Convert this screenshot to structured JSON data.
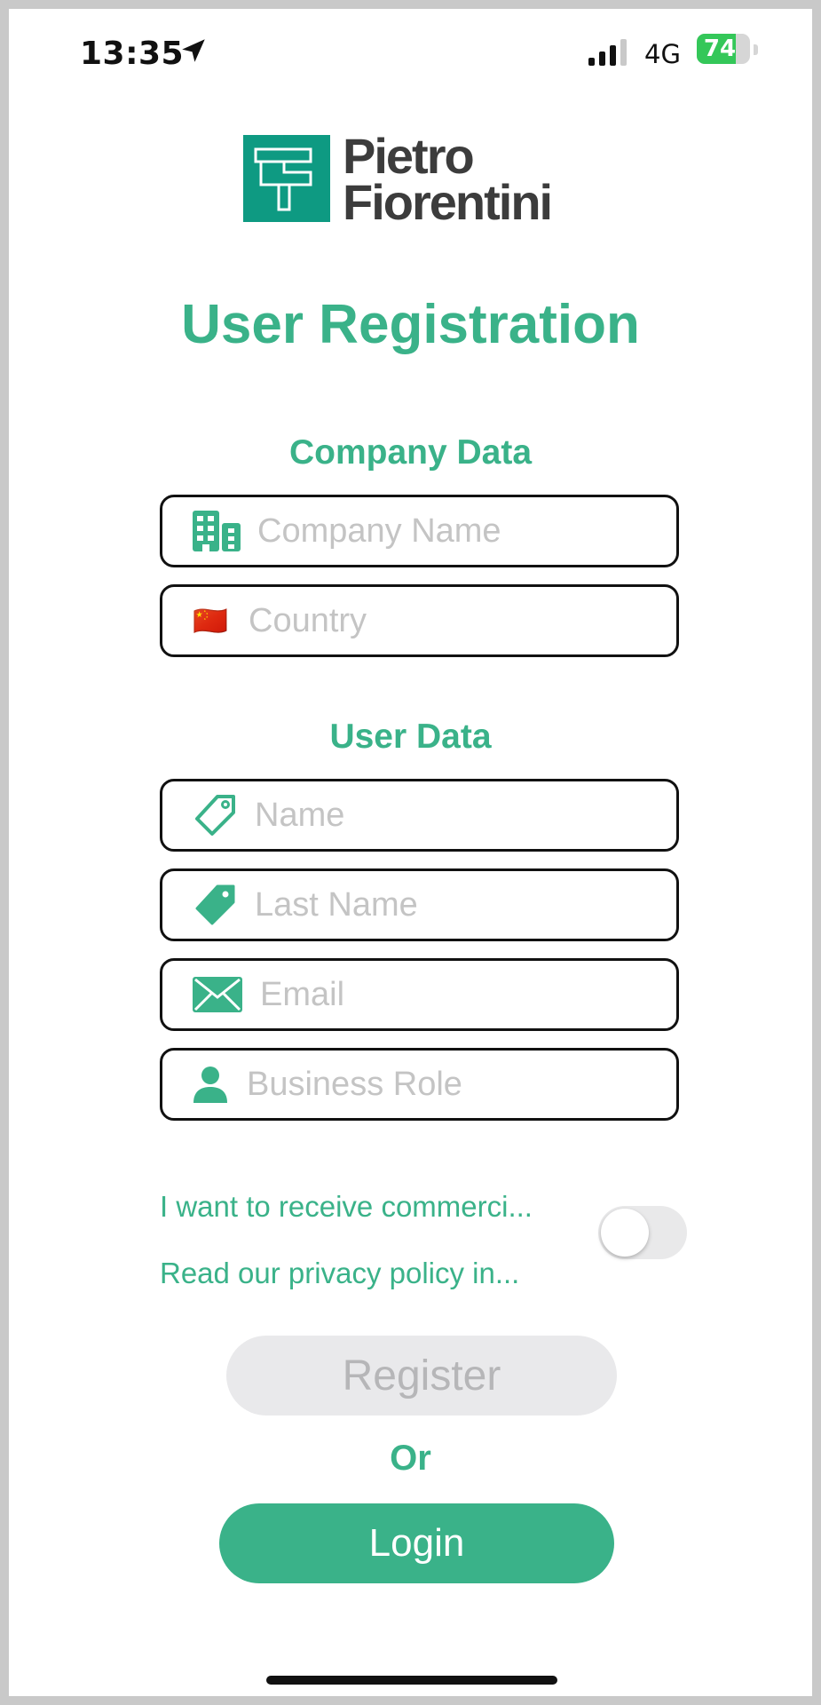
{
  "status_bar": {
    "time": "13:35",
    "network": "4G",
    "battery": "74",
    "battery_level": 0.74
  },
  "logo": {
    "line1": "Pietro",
    "line2": "Fiorentini"
  },
  "title": "User Registration",
  "company_section": {
    "title": "Company Data",
    "company_name_placeholder": "Company Name",
    "country_placeholder": "Country",
    "country_flag": "🇨🇳"
  },
  "user_section": {
    "title": "User Data",
    "name_placeholder": "Name",
    "last_name_placeholder": "Last Name",
    "email_placeholder": "Email",
    "business_role_placeholder": "Business Role"
  },
  "consent": {
    "commercial_text": "I want to receive commerci...",
    "privacy_text": "Read our privacy policy in...",
    "toggle_on": false
  },
  "actions": {
    "register_label": "Register",
    "or_label": "Or",
    "login_label": "Login"
  },
  "colors": {
    "accent": "#3ab289",
    "logo_green": "#0e9a82",
    "battery_green": "#34c759"
  },
  "icons": [
    "location-arrow-icon",
    "signal-icon",
    "battery-icon",
    "building-icon",
    "flag-icon",
    "tag-outline-icon",
    "tag-filled-icon",
    "envelope-icon",
    "person-icon"
  ]
}
